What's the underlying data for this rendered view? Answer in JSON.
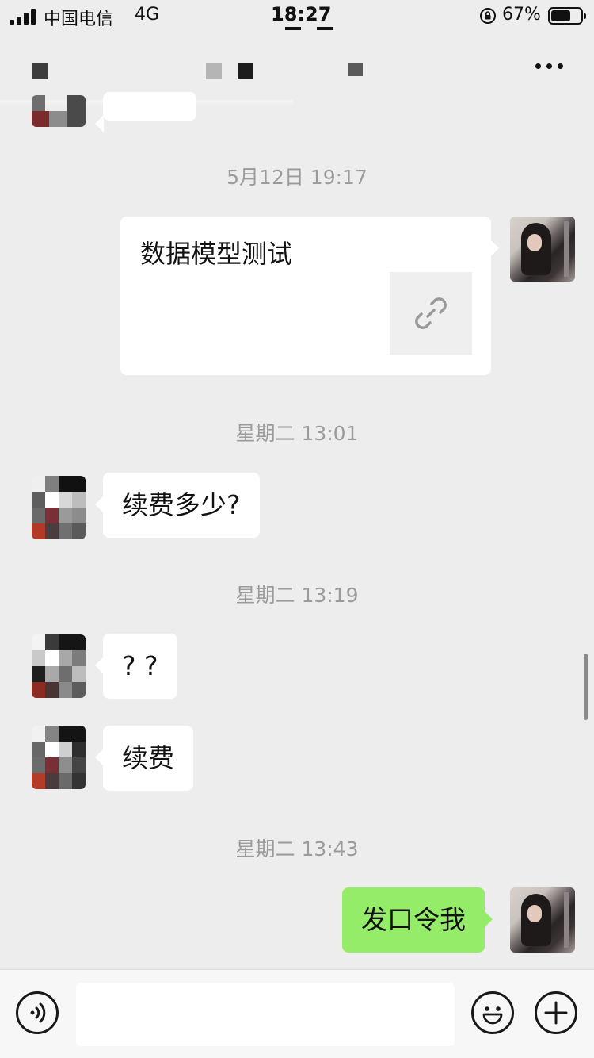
{
  "status_bar": {
    "carrier": "中国电信",
    "network": "4G",
    "time": "18:27",
    "battery_percent": "67%",
    "battery_level": 0.67
  },
  "nav": {
    "title": "",
    "more_icon": "more-horizontal-icon"
  },
  "messages": [
    {
      "type": "timestamp",
      "text": "5月12日 19:17"
    },
    {
      "type": "link",
      "sender": "me",
      "title": "数据模型测试",
      "icon": "link-icon"
    },
    {
      "type": "timestamp",
      "text": "星期二 13:01"
    },
    {
      "type": "text",
      "sender": "other",
      "text": "续费多少?"
    },
    {
      "type": "timestamp",
      "text": "星期二 13:19"
    },
    {
      "type": "text",
      "sender": "other",
      "text": "? ?"
    },
    {
      "type": "text",
      "sender": "other",
      "text": "续费"
    },
    {
      "type": "timestamp",
      "text": "星期二 13:43"
    },
    {
      "type": "text",
      "sender": "me",
      "text": "发口令我"
    }
  ],
  "input_bar": {
    "voice_icon": "voice-icon",
    "input_value": "",
    "emoji_icon": "emoji-icon",
    "add_icon": "plus-icon"
  },
  "colors": {
    "chat_background": "#ededed",
    "my_bubble": "#95ec69",
    "other_bubble": "#ffffff",
    "timestamp_text": "#9b9b9b"
  }
}
